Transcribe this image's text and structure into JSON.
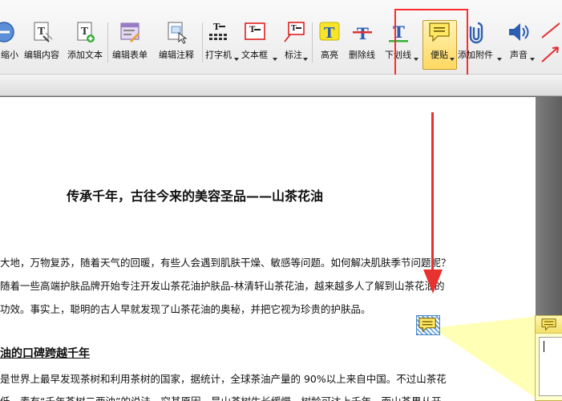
{
  "toolbar": {
    "buttons": [
      {
        "label": "缩小",
        "icon": "zoom-out-icon"
      },
      {
        "label": "编辑内容",
        "icon": "edit-content-icon"
      },
      {
        "label": "添加文本",
        "icon": "add-text-icon"
      },
      {
        "label": "编辑表单",
        "icon": "edit-form-icon"
      },
      {
        "label": "编辑注释",
        "icon": "edit-annotation-icon"
      },
      {
        "label": "打字机",
        "icon": "typewriter-icon"
      },
      {
        "label": "文本框",
        "icon": "text-box-icon"
      },
      {
        "label": "标注",
        "icon": "callout-icon"
      },
      {
        "label": "高亮",
        "icon": "highlight-icon"
      },
      {
        "label": "删除线",
        "icon": "strikethrough-icon"
      },
      {
        "label": "下划线",
        "icon": "underline-icon"
      },
      {
        "label": "便贴",
        "icon": "sticky-note-icon"
      },
      {
        "label": "添加附件",
        "icon": "attachment-icon"
      },
      {
        "label": "声音",
        "icon": "sound-icon"
      }
    ],
    "selected_tool": "便贴",
    "colors": {
      "highlight_box": "#ff2a2a",
      "sticky_yellow": "#ffd860"
    }
  },
  "document": {
    "title": "传承千年，古往今来的美容圣品——山茶花油",
    "paragraph_lines": [
      "大地，万物复苏，随着天气的回暖，有些人会遇到肌肤干燥、敏感等问题。如何解决肌肤季节问题呢？",
      "随着一些高端护肤品牌开始专注开发山茶花油护肤品-林清轩山茶花油，越来越多人了解到山茶花油的",
      "功效。事实上，聪明的古人早就发现了山茶花油的奥秘，并把它视为珍贵的护肤品。"
    ],
    "section_heading": "油的口碑跨越千年",
    "section_lines": [
      "是世界上最早发现茶树和利用茶树的国家，据统计，全球茶油产量的 90%以上来自中国。不过山茶花",
      "低，素有“千年茶树二两油”的说法，究其原因，是山茶树生长缓慢，树龄可达上千年，而山茶果从开"
    ]
  },
  "annotations": {
    "arrow_color": "#e8322f",
    "sticky_note": {
      "icon": "sticky-note-icon",
      "popup_text": ""
    }
  }
}
